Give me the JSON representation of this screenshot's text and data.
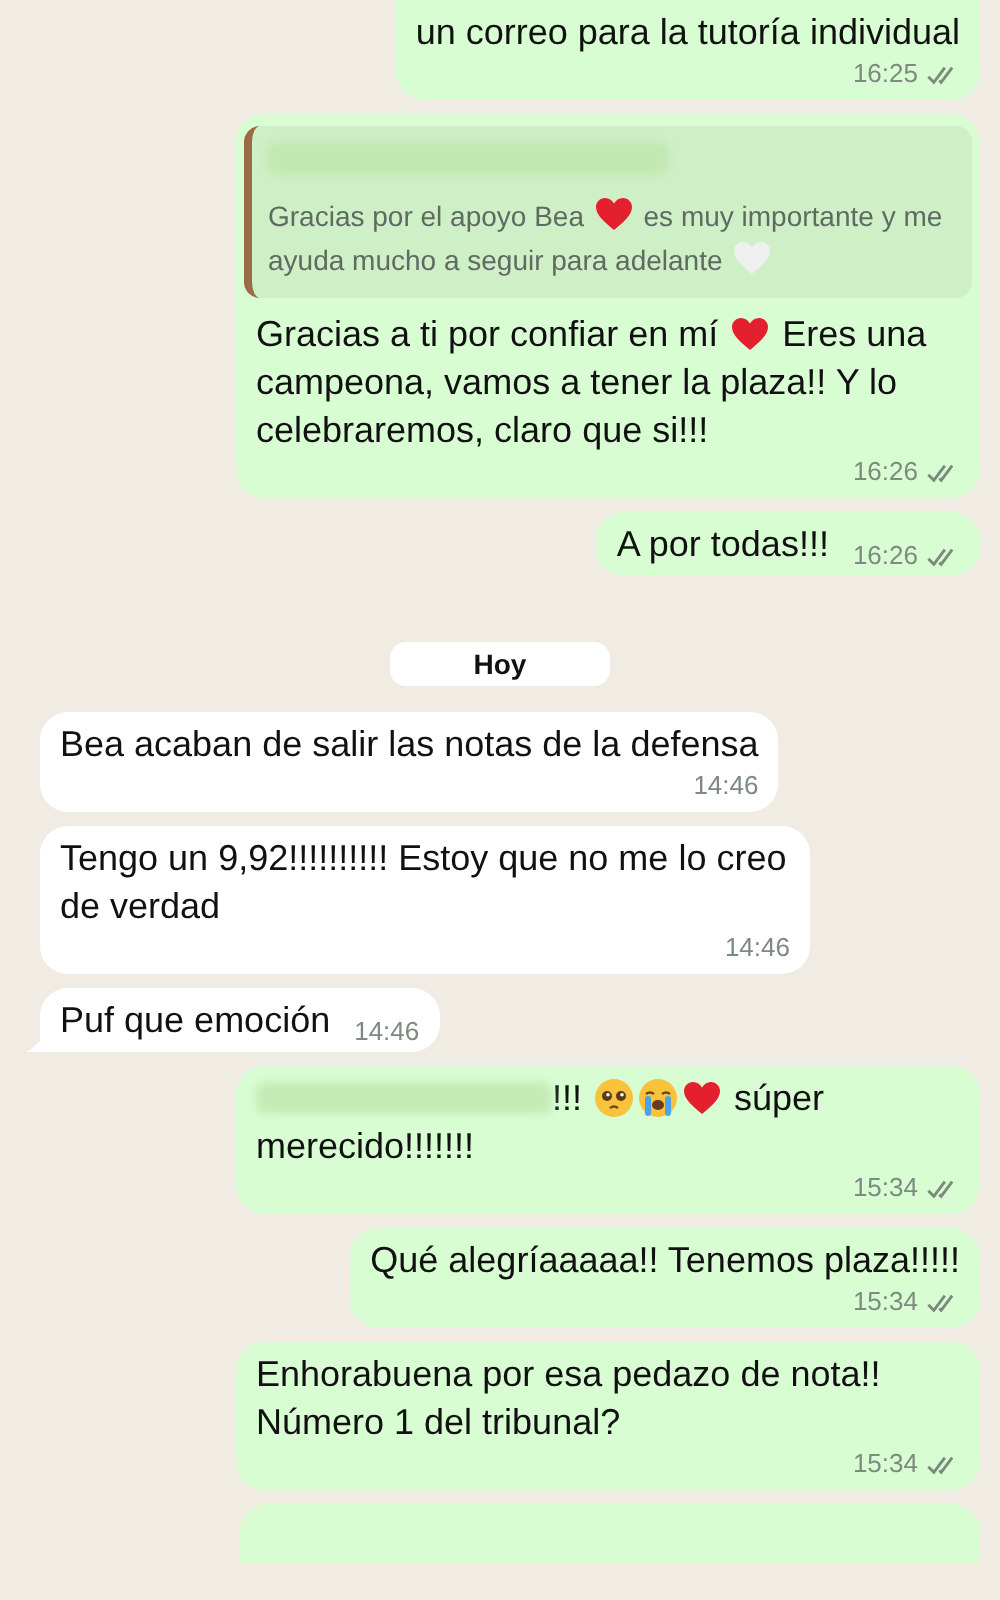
{
  "messages": [
    {
      "kind": "out",
      "parts": [
        {
          "kind": "text",
          "text": "un correo para la tutoría individual"
        }
      ],
      "time": "16:25",
      "read": false,
      "cut_top": true
    },
    {
      "kind": "out",
      "quote": {
        "parts": [
          {
            "kind": "text",
            "text": "Gracias por el apoyo Bea "
          },
          {
            "kind": "heart"
          },
          {
            "kind": "text",
            "text": " es muy importante y me ayuda mucho a seguir para adelante "
          },
          {
            "kind": "white-heart"
          }
        ]
      },
      "parts": [
        {
          "kind": "text",
          "text": "Gracias a ti por confiar en mí "
        },
        {
          "kind": "heart"
        },
        {
          "kind": "text",
          "text": " Eres una campeona, vamos a tener la plaza!! Y lo celebraremos, claro que si!!!"
        }
      ],
      "time": "16:26",
      "read": false
    },
    {
      "kind": "out",
      "parts": [
        {
          "kind": "text",
          "text": "A por todas!!!"
        }
      ],
      "time": "16:26",
      "read": false,
      "inline_time": true
    },
    {
      "kind": "date",
      "text": "Hoy"
    },
    {
      "kind": "in",
      "parts": [
        {
          "kind": "text",
          "text": "Bea acaban de salir las notas de la defensa"
        }
      ],
      "time": "14:46"
    },
    {
      "kind": "in",
      "parts": [
        {
          "kind": "text",
          "text": "Tengo un 9,92!!!!!!!!!! Estoy que no me lo creo de verdad"
        }
      ],
      "time": "14:46"
    },
    {
      "kind": "in",
      "parts": [
        {
          "kind": "text",
          "text": "Puf que emoción"
        }
      ],
      "time": "14:46",
      "inline_time": true,
      "tail": true
    },
    {
      "kind": "out",
      "parts": [
        {
          "kind": "redacted"
        },
        {
          "kind": "text",
          "text": "!!! "
        },
        {
          "kind": "pleading"
        },
        {
          "kind": "crying"
        },
        {
          "kind": "heart"
        },
        {
          "kind": "text",
          "text": " súper merecido!!!!!!!"
        }
      ],
      "time": "15:34",
      "read": false
    },
    {
      "kind": "out",
      "parts": [
        {
          "kind": "text",
          "text": "Qué alegríaaaaa!! Tenemos plaza!!!!!"
        }
      ],
      "time": "15:34",
      "read": false
    },
    {
      "kind": "out",
      "parts": [
        {
          "kind": "text",
          "text": "Enhorabuena por esa pedazo de nota!! Número 1 del tribunal?"
        }
      ],
      "time": "15:34",
      "read": false
    },
    {
      "kind": "out",
      "cut_bottom": true
    }
  ]
}
